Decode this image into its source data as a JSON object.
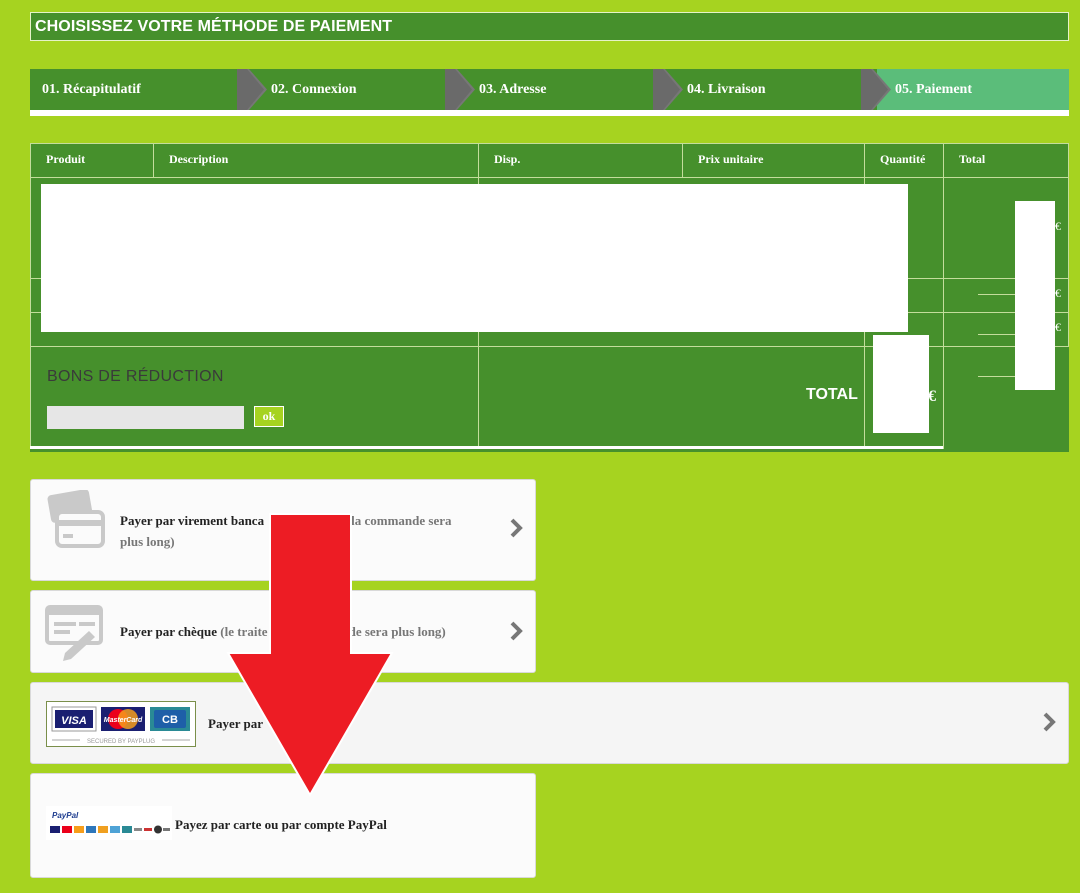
{
  "header": {
    "title": "CHOISISSEZ VOTRE MÉTHODE DE PAIEMENT"
  },
  "steps": [
    {
      "label": "01. Récapitulatif"
    },
    {
      "label": "02. Connexion"
    },
    {
      "label": "03. Adresse"
    },
    {
      "label": "04. Livraison"
    },
    {
      "label": "05. Paiement"
    }
  ],
  "cart": {
    "columns": [
      "Produit",
      "Description",
      "Disp.",
      "Prix unitaire",
      "Quantité",
      "Total"
    ],
    "currency_symbol": "€",
    "voucher": {
      "title": "BONS DE RÉDUCTION",
      "input_value": "",
      "ok_label": "ok"
    },
    "total_label": "TOTAL"
  },
  "payments": [
    {
      "title": "Payer par virement banca",
      "note": "nt de la commande sera",
      "note2": "plus long)",
      "icon": "credit-card-icon"
    },
    {
      "title": "Payer par chèque",
      "note": "(le traite",
      "note2": "amande sera plus long)",
      "icon": "cheque-icon"
    },
    {
      "title": "Payer par",
      "icon": "card-brands-logo",
      "logo_text": {
        "visa": "VISA",
        "mastercard": "MasterCard",
        "cb": "CB",
        "secured": "SECURED BY PAYPLUG"
      }
    },
    {
      "title": "Payez par carte ou par compte PayPal",
      "icon": "paypal-logo",
      "logo_text": {
        "paypal": "PayPal"
      }
    }
  ],
  "colors": {
    "background": "#a6d320",
    "primary_green": "#46902c",
    "active_step": "#5bbd7a",
    "arrow_red": "#ed1c24"
  }
}
